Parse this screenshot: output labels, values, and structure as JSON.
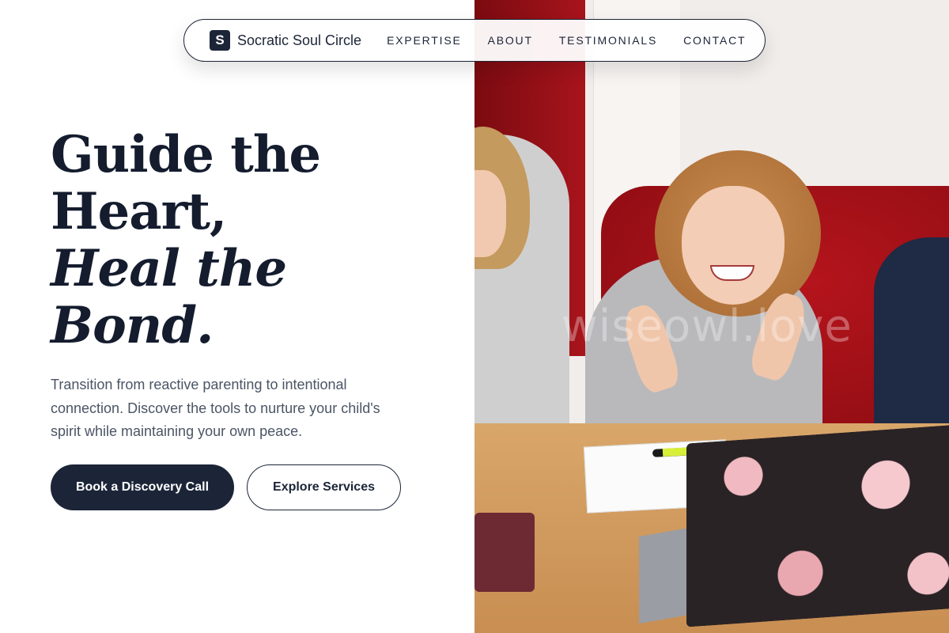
{
  "nav": {
    "brand_mark": "S",
    "brand_name": "Socratic Soul Circle",
    "links": [
      "EXPERTISE",
      "ABOUT",
      "TESTIMONIALS",
      "CONTACT"
    ]
  },
  "hero": {
    "headline_line1": "Guide the",
    "headline_line2": "Heart,",
    "headline_line3": "Heal the",
    "headline_line4": "Bond.",
    "description": "Transition from reactive parenting to intentional connection. Discover the tools to nurture your child's spirit while maintaining your own peace.",
    "primary_cta": "Book a Discovery Call",
    "secondary_cta": "Explore Services"
  },
  "photo": {
    "watermark": "wiseowl.love"
  },
  "colors": {
    "brand_dark": "#1c2538",
    "text_muted": "#4b5565",
    "background": "#ffffff"
  }
}
